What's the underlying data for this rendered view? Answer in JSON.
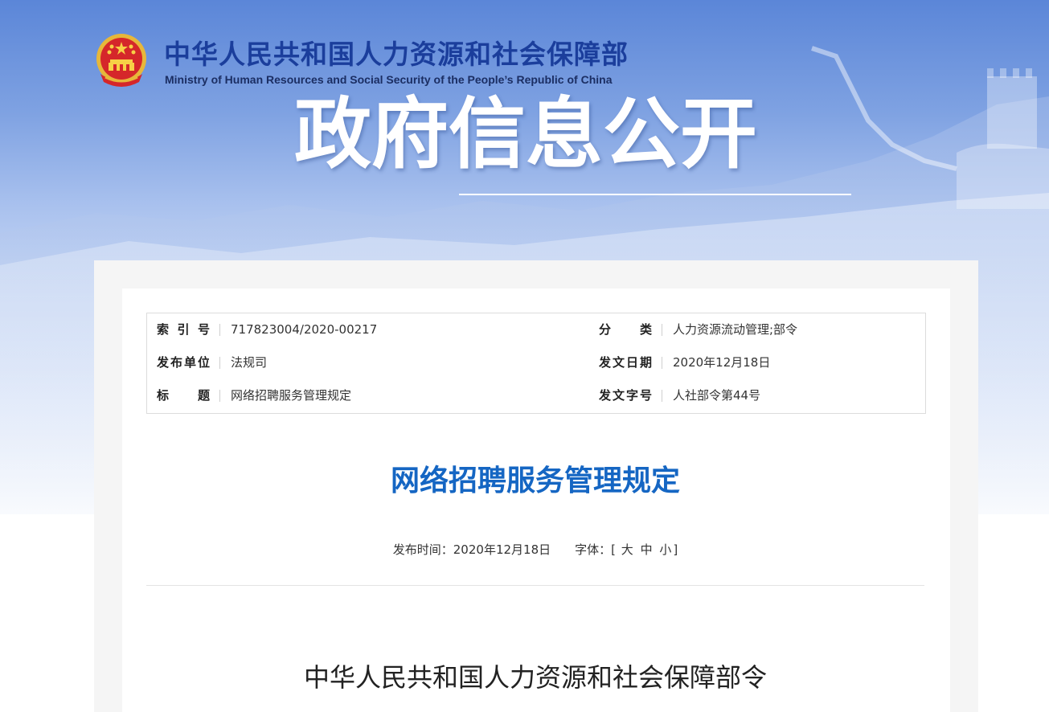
{
  "header": {
    "ministry_cn": "中华人民共和国人力资源和社会保障部",
    "ministry_en": "Ministry of Human Resources and Social Security of the People’s Republic of China",
    "banner_title": "政府信息公开",
    "emblem_icon": "national-emblem-icon"
  },
  "meta": {
    "index_label": "索 引 号",
    "index_value": "717823004/2020-00217",
    "category_label": "分 类",
    "category_value": "人力资源流动管理;部令",
    "publisher_label": "发布单位",
    "publisher_value": "法规司",
    "issue_date_label": "发文日期",
    "issue_date_value": "2020年12月18日",
    "title_label": "标 题",
    "title_value": "网络招聘服务管理规定",
    "doc_number_label": "发文字号",
    "doc_number_value": "人社部令第44号"
  },
  "article": {
    "title": "网络招聘服务管理规定",
    "publish_time_label": "发布时间：",
    "publish_time_value": "2020年12月18日",
    "font_label": "字体：",
    "font_open": "[",
    "font_large": "大",
    "font_medium": "中",
    "font_small": "小",
    "font_close": "]",
    "order_heading": "中华人民共和国人力资源和社会保障部令"
  },
  "colors": {
    "title_blue": "#1566c3",
    "ministry_blue": "#1b3e9c"
  }
}
